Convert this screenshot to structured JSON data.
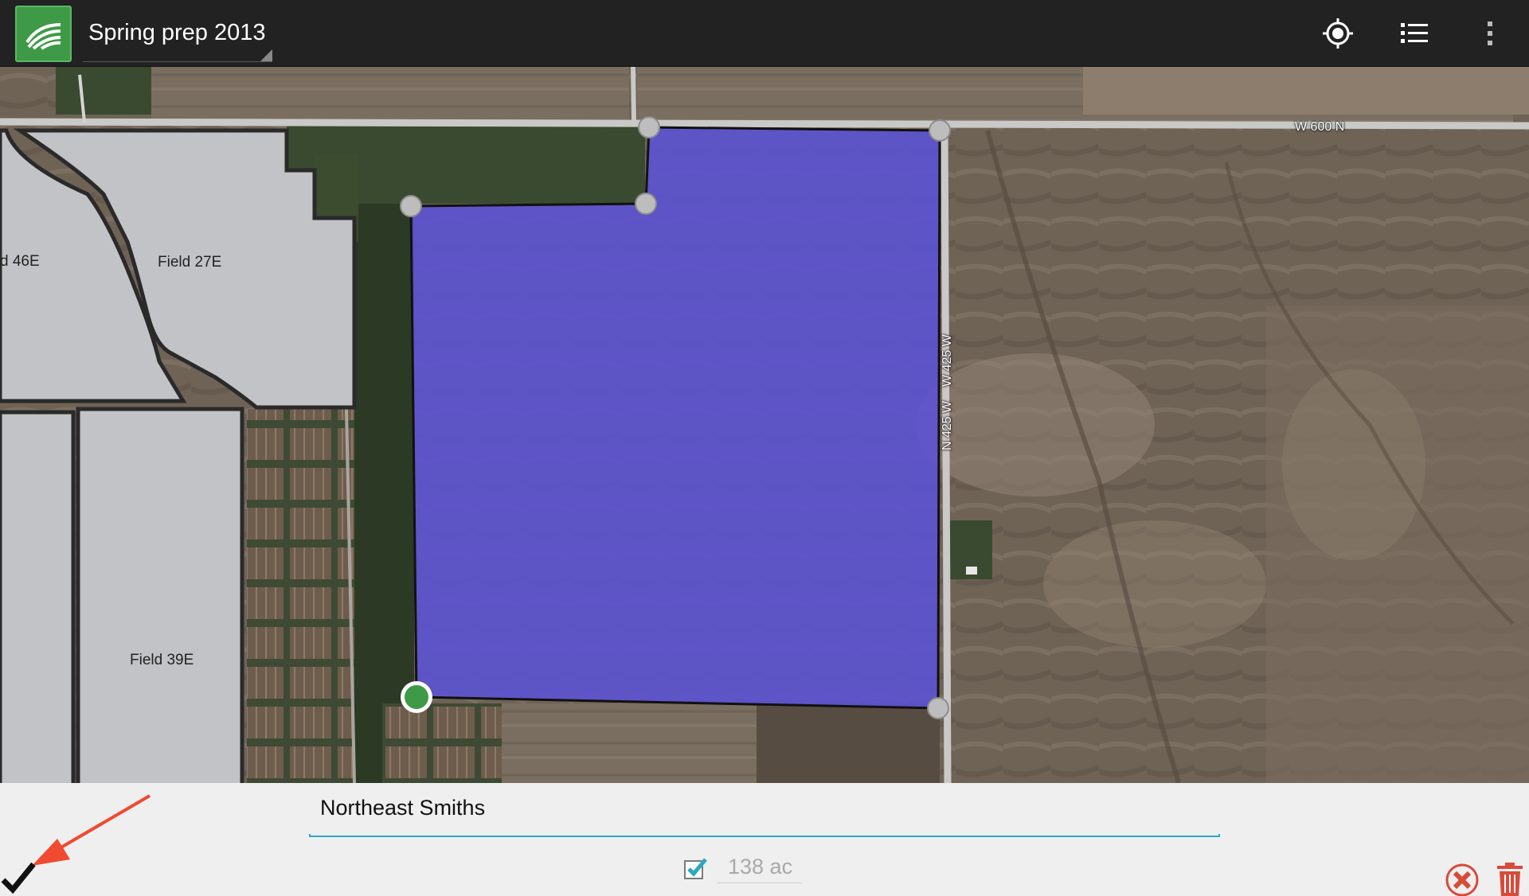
{
  "actionbar": {
    "title": "Spring prep 2013",
    "icons": [
      "app-logo-icon",
      "my-location-icon",
      "list-icon",
      "overflow-menu-icon"
    ]
  },
  "map": {
    "field_labels": {
      "field_46e": "d 46E",
      "field_27e": "Field 27E",
      "field_39e": "Field 39E"
    },
    "road_labels": {
      "w600n": "W 600 N",
      "n425w": "N 425 W",
      "w425w": "W 425 W"
    },
    "colors": {
      "selected_field": "#5b52d6",
      "other_fields": "#c2c3c6",
      "vertex": "#bdbdbd",
      "active_vertex": "#3e9a47"
    }
  },
  "editor": {
    "field_name_value": "Northeast Smiths",
    "area_checkbox_checked": true,
    "area_value": "138 ac",
    "accent_color": "#2aa9c4",
    "arrow_color": "#f04a30",
    "icons": [
      "confirm-check-icon",
      "cancel-icon",
      "trash-icon"
    ]
  }
}
